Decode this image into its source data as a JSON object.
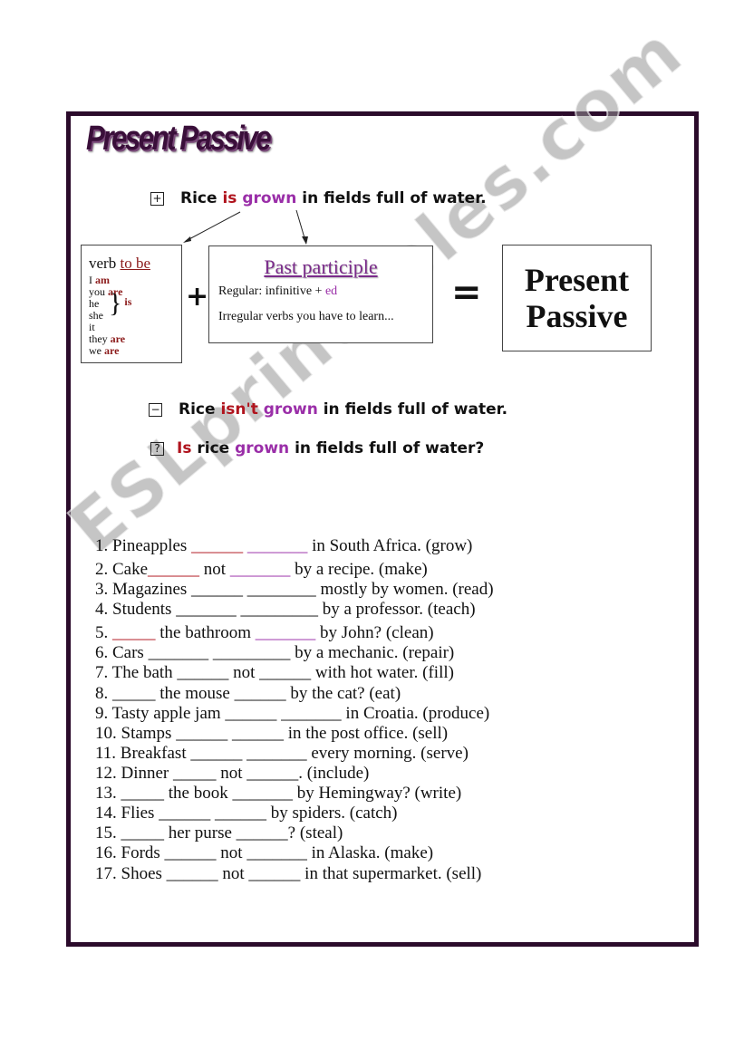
{
  "title": "Present Passive",
  "affirmative": {
    "symbol": "+",
    "parts": [
      {
        "t": "Rice "
      },
      {
        "t": "is",
        "c": "red"
      },
      {
        "t": " "
      },
      {
        "t": "grown",
        "c": "pur"
      },
      {
        "t": " in fields full of water."
      }
    ]
  },
  "verb_box": {
    "heading_a": "verb ",
    "heading_b": "to be",
    "rows": [
      [
        "I ",
        "am"
      ],
      [
        "you ",
        "are"
      ],
      [
        "he",
        ""
      ],
      [
        "she",
        ""
      ],
      [
        "it",
        ""
      ],
      [
        "they ",
        "are"
      ],
      [
        "we ",
        "are"
      ]
    ],
    "is": "is"
  },
  "plus": "+",
  "pp_box": {
    "heading": "Past participle",
    "regular_a": "Regular: infinitive + ",
    "regular_b": "ed",
    "irregular": "Irregular verbs you have to learn..."
  },
  "equals": "=",
  "result_box": {
    "line1": "Present",
    "line2": "Passive"
  },
  "negative": {
    "symbol": "−",
    "parts": [
      {
        "t": "Rice "
      },
      {
        "t": "isn't",
        "c": "red"
      },
      {
        "t": " "
      },
      {
        "t": "grown",
        "c": "pur"
      },
      {
        "t": " in fields full of water."
      }
    ]
  },
  "question": {
    "symbol": "?",
    "parts": [
      {
        "t": "Is",
        "c": "red"
      },
      {
        "t": " rice "
      },
      {
        "t": "grown",
        "c": "pur"
      },
      {
        "t": " in fields full of water?"
      }
    ]
  },
  "exercises": [
    [
      {
        "t": "1. Pineapples "
      },
      {
        "t": "______",
        "c": "red"
      },
      {
        "t": " "
      },
      {
        "t": "_______",
        "c": "pur"
      },
      {
        "t": " in South Africa. (grow)"
      }
    ],
    [
      {
        "t": "2. Cake"
      },
      {
        "t": "______",
        "c": "red"
      },
      {
        "t": " not "
      },
      {
        "t": "_______",
        "c": "pur"
      },
      {
        "t": " by  a recipe. (make)"
      }
    ],
    [
      {
        "t": "3. Magazines ______ ________ mostly by women. (read)"
      }
    ],
    [
      {
        "t": "4. Students _______ _________ by a professor. (teach)"
      }
    ],
    [
      {
        "t": "5. "
      },
      {
        "t": "_____",
        "c": "red"
      },
      {
        "t": " the bathroom "
      },
      {
        "t": "_______",
        "c": "pur"
      },
      {
        "t": " by John? (clean)"
      }
    ],
    [
      {
        "t": "6. Cars _______ _________ by a mechanic. (repair)"
      }
    ],
    [
      {
        "t": "7. The bath ______ not ______ with hot water. (fill)"
      }
    ],
    [
      {
        "t": "8. _____ the mouse ______ by the cat? (eat)"
      }
    ],
    [
      {
        "t": "9. Tasty apple jam ______ _______ in Croatia. (produce)"
      }
    ],
    [
      {
        "t": "10. Stamps ______ ______ in the post office. (sell)"
      }
    ],
    [
      {
        "t": "11. Breakfast ______ _______ every morning. (serve)"
      }
    ],
    [
      {
        "t": "12. Dinner _____ not ______. (include)"
      }
    ],
    [
      {
        "t": "13. _____ the book _______ by Hemingway? (write)"
      }
    ],
    [
      {
        "t": "14. Flies ______ ______ by spiders. (catch)"
      }
    ],
    [
      {
        "t": "15. _____ her purse ______? (steal)"
      }
    ],
    [
      {
        "t": "16. Fords ______ not _______ in Alaska. (make)"
      }
    ],
    [
      {
        "t": "17. Shoes ______ not ______ in that supermarket. (sell)"
      }
    ]
  ],
  "watermark": "ESLprintables.com",
  "colors": {
    "red": "#b0141e",
    "purple": "#9a2ea8",
    "frame": "#2b0b2b"
  }
}
